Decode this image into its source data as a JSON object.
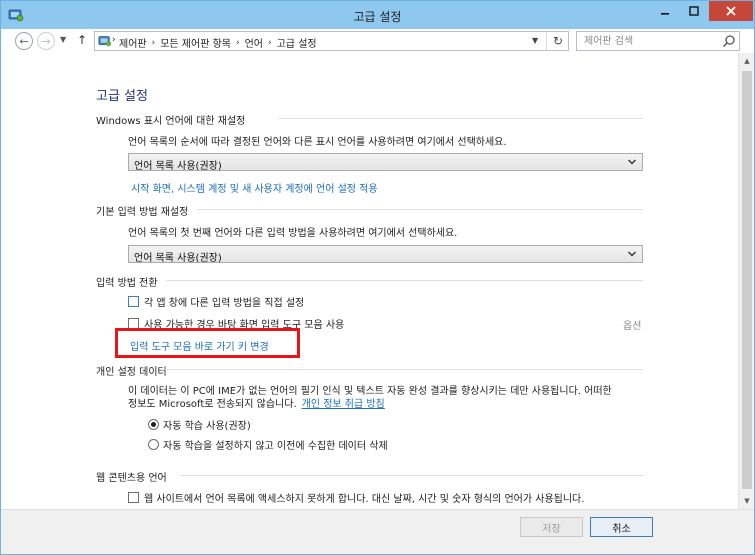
{
  "window": {
    "title": "고급 설정"
  },
  "nav": {
    "breadcrumbs": [
      "제어판",
      "모든 제어판 항목",
      "언어",
      "고급 설정"
    ],
    "search_placeholder": "제어판 검색"
  },
  "page": {
    "heading": "고급 설정",
    "sections": {
      "display_language": {
        "title": "Windows 표시 언어에 대한 재설정",
        "description": "언어 목록의 순서에 따라 결정된 언어와 다른 표시 언어를 사용하려면 여기에서 선택하세요.",
        "selected": "언어 목록 사용(권장)",
        "link": "시작 화면, 시스템 계정 및 새 사용자 계정에 언어 설정 적용"
      },
      "input_method": {
        "title": "기본 입력 방법 재설정",
        "description": "언어 목록의 첫 번째 언어와 다른 입력 방법을 사용하려면 여기에서 선택하세요.",
        "selected": "언어 목록 사용(권장)"
      },
      "switching": {
        "title": "입력 방법 전환",
        "per_app_label": "각 앱 창에 다른 입력 방법을 직접 설정",
        "per_app_checked": false,
        "desktop_bar_label": "사용 가능한 경우 바탕 화면 입력 도구 모음 사용",
        "desktop_bar_checked": false,
        "options_label": "옵션",
        "hotkeys_link": "입력 도구 모음 바로 가기 키 변경"
      },
      "personalization": {
        "title": "개인 설정 데이터",
        "description_line1": "이 데이터는 이 PC에 IME가 없는 언어의 필기 인식 및 텍스트 자동 완성 결과를 향상시키는 데만 사용됩니다. 어떠한",
        "description_line2": "정보도 Microsoft로 전송되지 않습니다.",
        "privacy_link": "개인 정보 취급 방침",
        "radio_auto": "자동 학습 사용(권장)",
        "radio_auto_selected": true,
        "radio_off": "자동 학습을 설정하지 않고 이전에 수집한 데이터 삭제",
        "radio_off_selected": false
      },
      "web_content": {
        "title": "웹 콘텐츠용 언어",
        "checkbox_label": "웹 사이트에서 언어 목록에 액세스하지 못하게 합니다. 대신 날짜, 시간 및 숫자 형식의 언어가 사용됩니다.",
        "checkbox_checked": false
      }
    }
  },
  "footer": {
    "save_label": "저장",
    "cancel_label": "취소"
  },
  "colors": {
    "titlebar": "#8fc8ee",
    "heading": "#1e3287",
    "link": "#1b6ec2",
    "highlight": "#e8141c",
    "close_button": "#c7463a"
  }
}
